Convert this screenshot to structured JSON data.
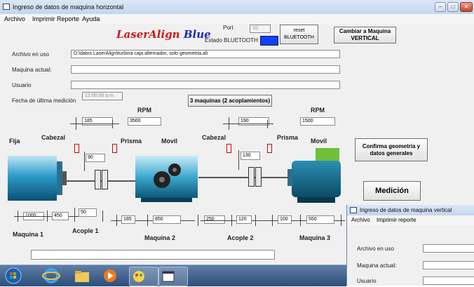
{
  "window": {
    "title": "Ingreso de datos de maquina  horizontal",
    "menu": [
      "Archivo",
      "Imprimir Reporte",
      "Ayuda"
    ]
  },
  "logo": {
    "part1": "LaserAlign",
    "part2": "Blue"
  },
  "bluetooth": {
    "port_label": "Port",
    "port_value": "10",
    "status_label": "Estado BLUETOOTH",
    "status_color": "#1040ff",
    "reset_label": "reset BLUETOOTH"
  },
  "buttons": {
    "vertical": "Cambiar a Maquina VERTICAL",
    "maquinas": "3 maquinas (2 acoplamientos)",
    "confirma": "Confirma geometría y datos generales",
    "medicion": "Medición"
  },
  "form": {
    "archivo_label": "Archivo en uso",
    "archivo_value": "D:\\datos LaserAlign\\turbina caja alternador, solo geometria.ali",
    "maquina_label": "Maquina actual:",
    "maquina_value": "",
    "usuario_label": "Usuario",
    "usuario_value": "",
    "fecha_label": "Fecha de última medición",
    "fecha_value": "12:00:00 a.m."
  },
  "diagram": {
    "rpm_label": "RPM",
    "rpm_1": "3500",
    "rpm_2": "1500",
    "fija": "Fija",
    "cabezal": "Cabezal",
    "prisma": "Prisma",
    "movil": "Movil",
    "maquina_1": "Maquina 1",
    "maquina_2": "Maquina 2",
    "maquina_3": "Maquina 3",
    "acople_1": "Acople 1",
    "acople_2": "Acople 2",
    "dims": {
      "a1_top": "185",
      "a1_mid": "90",
      "a1_bottom": "50",
      "m1_left": "1000",
      "m1_right": "450",
      "m2_left": "185",
      "m2_right": "850",
      "a2_left": "250",
      "a2_top": "190",
      "a2_mid": "130",
      "a2_bottom": "120",
      "m3_left": "100",
      "m3_right": "550"
    }
  },
  "window2": {
    "title": "Ingreso de datos de maquina vertical",
    "menu": [
      "Archivo",
      "Imprimir reporte"
    ],
    "archivo_label": "Archivo en uso",
    "maquina_label": "Maquina actual:",
    "usuario_label": "Usuario"
  },
  "taskbar": {
    "items": [
      "windows-start-icon",
      "internet-explorer-icon",
      "folder-icon",
      "media-player-icon",
      "paint-icon",
      "window-icon"
    ]
  }
}
